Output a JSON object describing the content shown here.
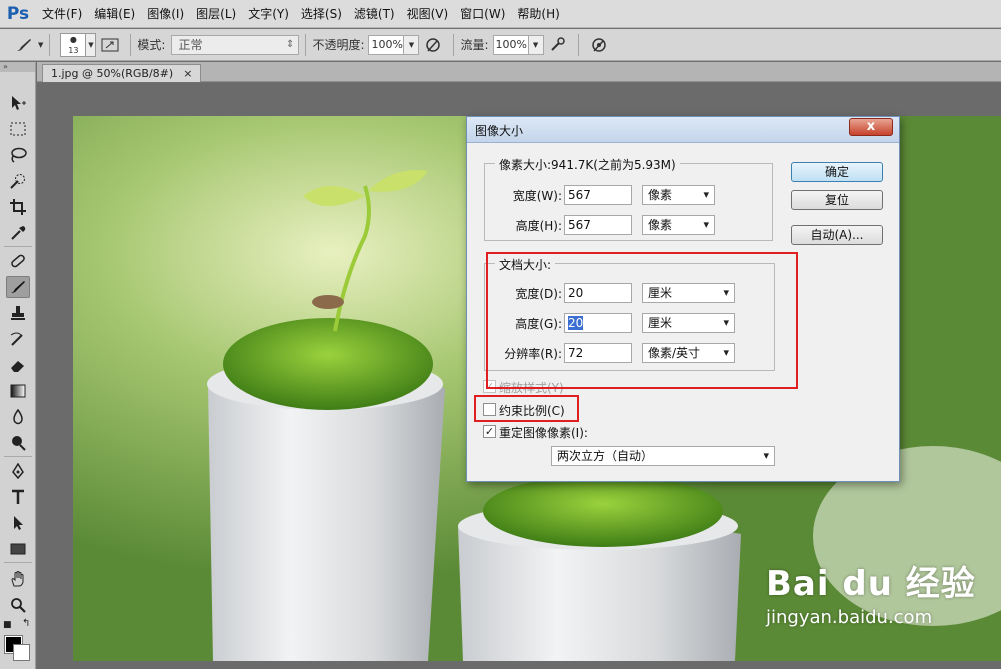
{
  "app": {
    "logo": "Ps"
  },
  "menu": [
    "文件(F)",
    "编辑(E)",
    "图像(I)",
    "图层(L)",
    "文字(Y)",
    "选择(S)",
    "滤镜(T)",
    "视图(V)",
    "窗口(W)",
    "帮助(H)"
  ],
  "options": {
    "brush_size": "13",
    "mode_label": "模式:",
    "mode_value": "正常",
    "opacity_label": "不透明度:",
    "opacity_value": "100%",
    "flow_label": "流量:",
    "flow_value": "100%"
  },
  "document": {
    "tab_title": "1.jpg @ 50%(RGB/8#)",
    "tab_close": "×"
  },
  "dialog": {
    "title": "图像大小",
    "close": "x",
    "pixel_group": {
      "legend": "像素大小:941.7K(之前为5.93M)",
      "width_label": "宽度(W):",
      "width_value": "567",
      "width_unit": "像素",
      "height_label": "高度(H):",
      "height_value": "567",
      "height_unit": "像素"
    },
    "doc_group": {
      "legend": "文档大小:",
      "width_label": "宽度(D):",
      "width_value": "20",
      "width_unit": "厘米",
      "height_label": "高度(G):",
      "height_value": "20",
      "height_unit": "厘米",
      "res_label": "分辨率(R):",
      "res_value": "72",
      "res_unit": "像素/英寸"
    },
    "buttons": {
      "ok": "确定",
      "reset": "复位",
      "auto": "自动(A)..."
    },
    "scale_styles": {
      "label": "缩放样式(Y)",
      "checked": true,
      "enabled": false
    },
    "constrain": {
      "label": "约束比例(C)",
      "checked": false
    },
    "resample": {
      "label": "重定图像像素(I):",
      "checked": true
    },
    "resample_method": "两次立方（自动）"
  },
  "watermark": {
    "main": "Bai du 经验",
    "sub": "jingyan.baidu.com"
  },
  "colors": {
    "highlight": "#e02020",
    "selection": "#3b6fd1"
  }
}
